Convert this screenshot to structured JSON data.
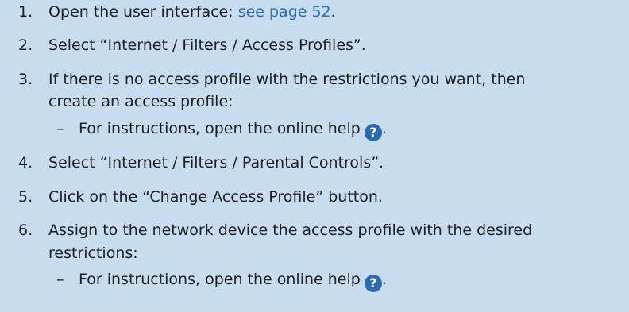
{
  "steps": [
    {
      "num": "1.",
      "text": "Open the user interface; ",
      "link": "see page 52",
      "end": "."
    },
    {
      "num": "2.",
      "text": "Select “Internet / Filters / Access Profiles”."
    },
    {
      "num": "3.",
      "text": "If there is no access profile with the restrictions you want, then",
      "cont": "create an access profile:"
    },
    {
      "num": "4.",
      "text": "Select “Internet / Filters / Parental Controls”."
    },
    {
      "num": "5.",
      "text": "Click on the “Change Access Profile” button."
    },
    {
      "num": "6.",
      "text": "Assign to the network device the access profile with the desired",
      "cont": "restrictions:"
    }
  ],
  "substeps": {
    "dash": "–",
    "step3": "For instructions, open the online help",
    "step6": "For instructions, open the online help",
    "end": "."
  },
  "help_icon": {
    "glyph": "?",
    "icon": "question-circle",
    "color": "#2b6cb0"
  }
}
